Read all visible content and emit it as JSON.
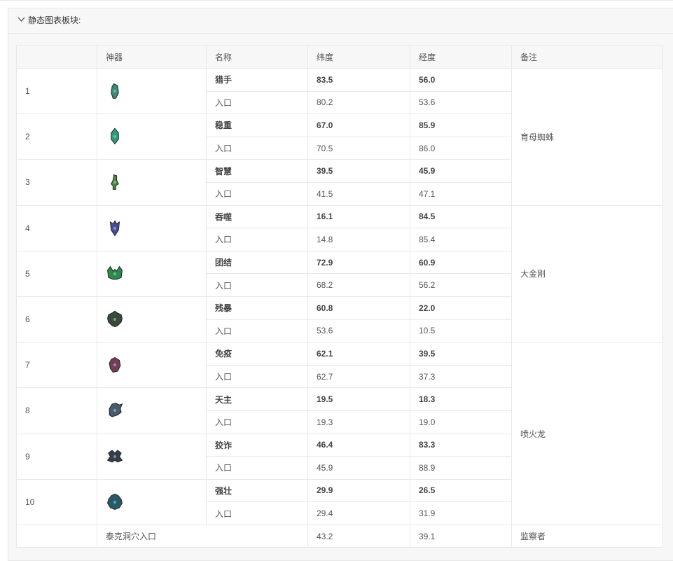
{
  "panel": {
    "title": "静态图表板块:"
  },
  "table": {
    "headers": [
      "神器",
      "名称",
      "纬度",
      "经度",
      "备注"
    ],
    "groups": [
      {
        "index": "1",
        "icon": "artifact-hunter-icon",
        "main": {
          "name": "猎手",
          "lat": "83.5",
          "lon": "56.0"
        },
        "entry": {
          "name": "入口",
          "lat": "80.2",
          "lon": "53.6"
        }
      },
      {
        "index": "2",
        "icon": "artifact-steadfast-icon",
        "main": {
          "name": "稳重",
          "lat": "67.0",
          "lon": "85.9"
        },
        "entry": {
          "name": "入口",
          "lat": "70.5",
          "lon": "86.0"
        }
      },
      {
        "index": "3",
        "icon": "artifact-clever-icon",
        "main": {
          "name": "智慧",
          "lat": "39.5",
          "lon": "45.9"
        },
        "entry": {
          "name": "入口",
          "lat": "41.5",
          "lon": "47.1"
        }
      },
      {
        "index": "4",
        "icon": "artifact-devourer-icon",
        "main": {
          "name": "吞噬",
          "lat": "16.1",
          "lon": "84.5"
        },
        "entry": {
          "name": "入口",
          "lat": "14.8",
          "lon": "85.4"
        }
      },
      {
        "index": "5",
        "icon": "artifact-pack-icon",
        "main": {
          "name": "团结",
          "lat": "72.9",
          "lon": "60.9"
        },
        "entry": {
          "name": "入口",
          "lat": "68.2",
          "lon": "56.2"
        }
      },
      {
        "index": "6",
        "icon": "artifact-brute-icon",
        "main": {
          "name": "残暴",
          "lat": "60.8",
          "lon": "22.0"
        },
        "entry": {
          "name": "入口",
          "lat": "53.6",
          "lon": "10.5"
        }
      },
      {
        "index": "7",
        "icon": "artifact-immune-icon",
        "main": {
          "name": "免疫",
          "lat": "62.1",
          "lon": "39.5"
        },
        "entry": {
          "name": "入口",
          "lat": "62.7",
          "lon": "37.3"
        }
      },
      {
        "index": "8",
        "icon": "artifact-massive-icon",
        "main": {
          "name": "天主",
          "lat": "19.5",
          "lon": "18.3"
        },
        "entry": {
          "name": "入口",
          "lat": "19.3",
          "lon": "19.0"
        }
      },
      {
        "index": "9",
        "icon": "artifact-cunning-icon",
        "main": {
          "name": "狡诈",
          "lat": "46.4",
          "lon": "83.3"
        },
        "entry": {
          "name": "入口",
          "lat": "45.9",
          "lon": "88.9"
        }
      },
      {
        "index": "10",
        "icon": "artifact-strong-icon",
        "main": {
          "name": "强壮",
          "lat": "29.9",
          "lon": "26.5"
        },
        "entry": {
          "name": "入口",
          "lat": "29.4",
          "lon": "31.9"
        }
      }
    ],
    "notes": [
      "育母蜘蛛",
      "大金刚",
      "喷火龙"
    ],
    "footer": {
      "name": "泰克洞穴入口",
      "lat": "43.2",
      "lon": "39.1",
      "note": "监察者"
    },
    "colors": {
      "artifact_1": "#3a8a78",
      "artifact_2": "#2f9a7a",
      "artifact_3": "#4a8a3a",
      "artifact_4": "#4a4a9a",
      "artifact_5": "#2e8a4a",
      "artifact_6": "#3a4a3a",
      "artifact_7": "#7a3a5a",
      "artifact_8": "#4a5a6a",
      "artifact_9": "#3a3a4a",
      "artifact_10": "#2a5a6a"
    }
  }
}
